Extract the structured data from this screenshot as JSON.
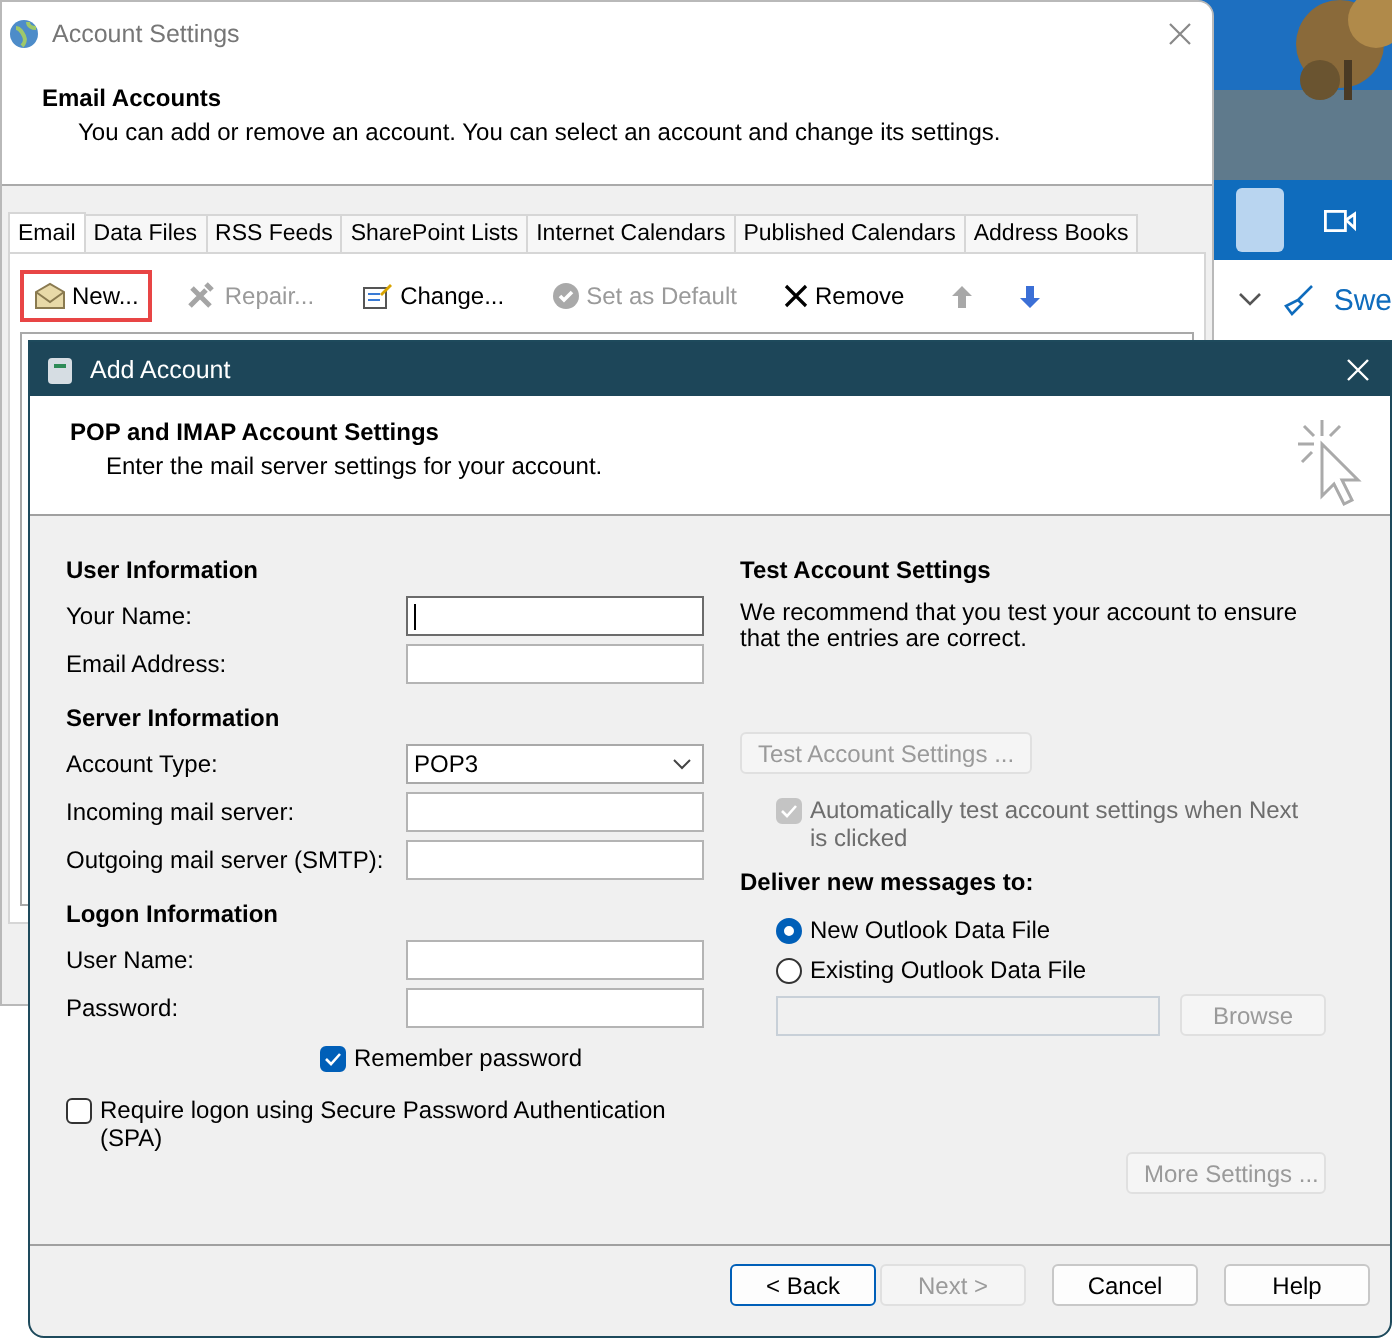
{
  "background_app": {
    "toolbar_text": "Swe"
  },
  "account_settings": {
    "title": "Account Settings",
    "header_title": "Email Accounts",
    "header_subtitle": "You can add or remove an account. You can select an account and change its settings.",
    "tabs": [
      {
        "label": "Email",
        "selected": true
      },
      {
        "label": "Data Files",
        "selected": false
      },
      {
        "label": "RSS Feeds",
        "selected": false
      },
      {
        "label": "SharePoint Lists",
        "selected": false
      },
      {
        "label": "Internet Calendars",
        "selected": false
      },
      {
        "label": "Published Calendars",
        "selected": false
      },
      {
        "label": "Address Books",
        "selected": false
      }
    ],
    "toolbar": [
      {
        "kind": "new",
        "label": "New...",
        "disabled": false,
        "highlighted": true
      },
      {
        "kind": "repair",
        "label": "Repair...",
        "disabled": true,
        "highlighted": false
      },
      {
        "kind": "change",
        "label": "Change...",
        "disabled": false,
        "highlighted": false
      },
      {
        "kind": "default",
        "label": "Set as Default",
        "disabled": true,
        "highlighted": false
      },
      {
        "kind": "remove",
        "label": "Remove",
        "disabled": false,
        "highlighted": false
      },
      {
        "kind": "up",
        "disabled": true,
        "highlighted": false
      },
      {
        "kind": "down",
        "disabled": false,
        "highlighted": false
      }
    ]
  },
  "add_account": {
    "title": "Add Account",
    "header_title": "POP and IMAP Account Settings",
    "header_subtitle": "Enter the mail server settings for your account.",
    "sections": [
      {
        "title": "User Information",
        "fields": [
          {
            "kind": "text",
            "label": "Your Name:",
            "focused": true
          },
          {
            "kind": "text",
            "label": "Email Address:",
            "focused": false
          }
        ]
      },
      {
        "title": "Server Information",
        "fields": [
          {
            "kind": "select",
            "label": "Account Type:",
            "value": "POP3"
          },
          {
            "kind": "text",
            "label": "Incoming mail server:",
            "focused": false
          },
          {
            "kind": "text",
            "label": "Outgoing mail server (SMTP):",
            "focused": false
          }
        ]
      },
      {
        "title": "Logon Information",
        "fields": [
          {
            "kind": "text",
            "label": "User Name:",
            "focused": false
          },
          {
            "kind": "text",
            "label": "Password:",
            "focused": false
          }
        ]
      }
    ],
    "remember_password": {
      "label": "Remember password",
      "checked": true
    },
    "require_spa": {
      "label": "Require logon using Secure Password Authentication (SPA)",
      "checked": false
    },
    "test_title": "Test Account Settings",
    "test_text": "We recommend that you test your account to ensure that the entries are correct.",
    "test_button": {
      "label": "Test Account Settings ...",
      "disabled": true
    },
    "auto_test": {
      "label": "Automatically test account settings when Next is clicked",
      "checked": true,
      "disabled": true
    },
    "deliver_title": "Deliver new messages to:",
    "deliver_options": [
      {
        "label": "New Outlook Data File",
        "selected": true
      },
      {
        "label": "Existing Outlook Data File",
        "selected": false
      }
    ],
    "file_field": {
      "disabled": true
    },
    "browse_button": {
      "label": "Browse",
      "disabled": true
    },
    "more_settings_button": {
      "label": "More Settings ...",
      "disabled": true
    },
    "buttons": [
      {
        "label": "< Back",
        "disabled": false,
        "default": true
      },
      {
        "label": "Next >",
        "disabled": true,
        "default": false
      },
      {
        "label": "Cancel",
        "disabled": false,
        "default": false
      },
      {
        "label": "Help",
        "disabled": false,
        "default": false
      }
    ]
  }
}
